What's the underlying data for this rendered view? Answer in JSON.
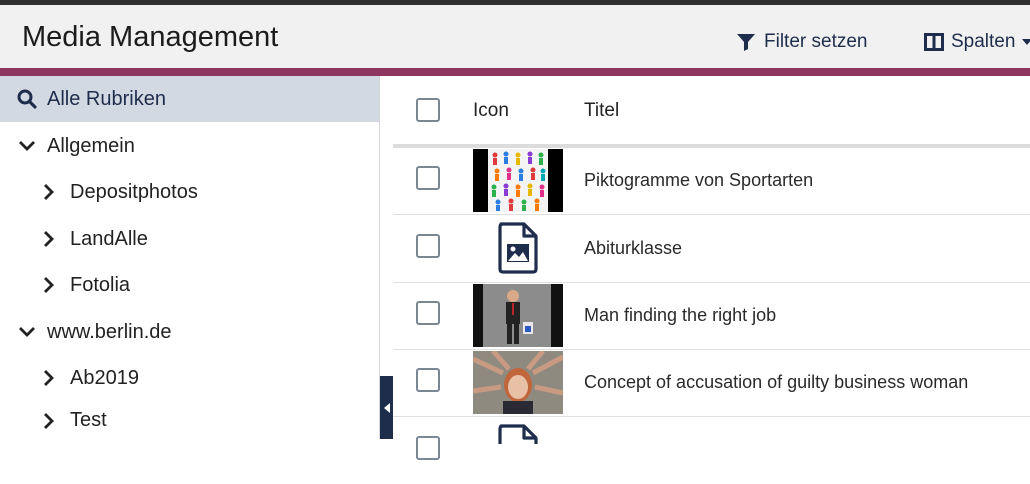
{
  "header": {
    "title": "Media Management",
    "filter_label": "Filter setzen",
    "columns_label": "Spalten"
  },
  "sidebar": {
    "search_label": "Alle Rubriken",
    "items": [
      {
        "label": "Allgemein",
        "expanded": true,
        "level": 0
      },
      {
        "label": "Depositphotos",
        "expanded": false,
        "level": 1
      },
      {
        "label": "LandAlle",
        "expanded": false,
        "level": 1
      },
      {
        "label": "Fotolia",
        "expanded": false,
        "level": 1
      },
      {
        "label": "www.berlin.de",
        "expanded": true,
        "level": 0
      },
      {
        "label": "Ab2019",
        "expanded": false,
        "level": 1
      },
      {
        "label": "Test",
        "expanded": false,
        "level": 1
      }
    ]
  },
  "table": {
    "columns": [
      "Icon",
      "Titel"
    ],
    "rows": [
      {
        "title": "Piktogramme von Sportarten",
        "icon": "sports-pictograms-thumbnail"
      },
      {
        "title": "Abiturklasse",
        "icon": "image-file-icon"
      },
      {
        "title": "Man finding the right job",
        "icon": "businessman-thumbnail"
      },
      {
        "title": "Concept of accusation of guilty business woman",
        "icon": "accused-woman-thumbnail"
      }
    ]
  },
  "colors": {
    "accent": "#8f3561",
    "navy": "#1f2d4d",
    "active_bg": "#d3d9e2"
  }
}
